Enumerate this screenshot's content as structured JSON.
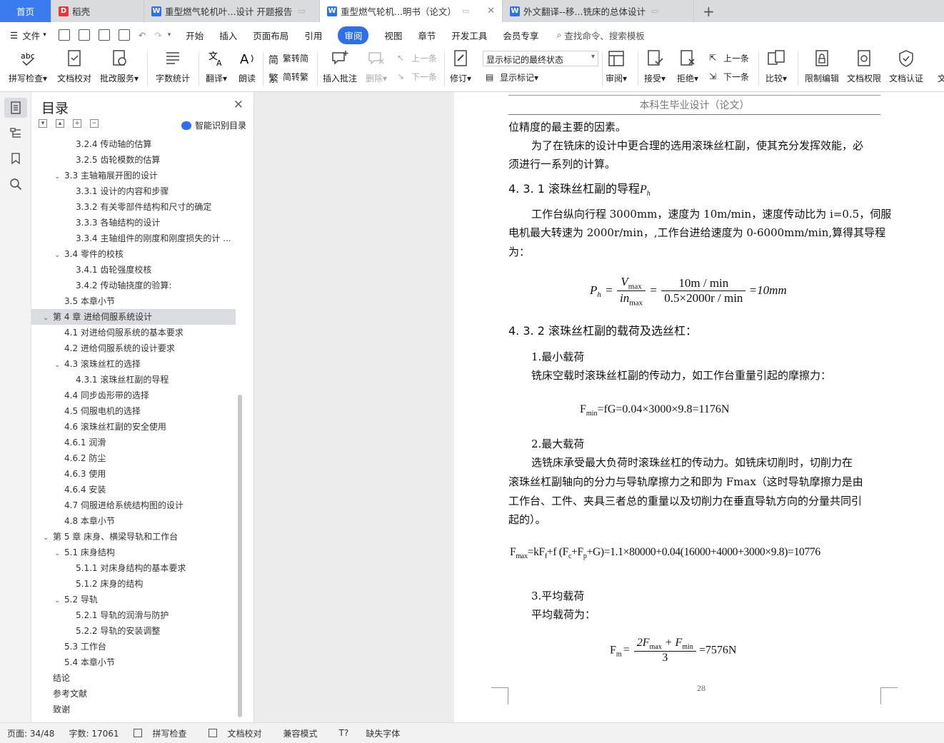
{
  "tabs": [
    {
      "label": "首页",
      "kind": "home"
    },
    {
      "label": "稻壳",
      "kind": "d"
    },
    {
      "label": "重型燃气轮机叶...设计 开题报告",
      "kind": "w"
    },
    {
      "label": "重型燃气轮机...明书（论文）",
      "kind": "w",
      "active": true
    },
    {
      "label": "外文翻译--移...铣床的总体设计",
      "kind": "w"
    }
  ],
  "menu": {
    "file": "文件",
    "items": [
      "开始",
      "插入",
      "页面布局",
      "引用",
      "审阅",
      "视图",
      "章节",
      "开发工具",
      "会员专享"
    ],
    "selected": "审阅",
    "search": "查找命令、搜索模板"
  },
  "ribbon": {
    "spell": "拼写检查",
    "doccheck": "文档校对",
    "correct": "批改服务",
    "wordcount": "字数统计",
    "translate": "翻译",
    "read": "朗读",
    "trad": "繁转简",
    "simp": "简转繁",
    "insert_comment": "插入批注",
    "delete": "删除",
    "prev1": "上一条",
    "next1": "下一条",
    "revise": "修订",
    "display_select": "显示标记的最终状态",
    "show_marks": "显示标记",
    "review": "审阅",
    "accept": "接受",
    "reject": "拒绝",
    "prev2": "上一条",
    "next2": "下一条",
    "compare": "比较",
    "limit_edit": "限制编辑",
    "doc_rights": "文档权限",
    "doc_cert": "文档认证",
    "doc_more": "文"
  },
  "toc": {
    "title": "目录",
    "smart": "智能识别目录",
    "items": [
      {
        "t": "3.2.4 传动轴的估算",
        "l": 3
      },
      {
        "t": "3.2.5 齿轮模数的估算",
        "l": 3
      },
      {
        "t": "3.3 主轴箱展开图的设计",
        "l": 2,
        "c": true
      },
      {
        "t": "3.3.1 设计的内容和步骤",
        "l": 3
      },
      {
        "t": "3.3.2  有关零部件结构和尺寸的确定",
        "l": 3
      },
      {
        "t": "3.3.3  各轴结构的设计",
        "l": 3
      },
      {
        "t": "3.3.4  主轴组件的刚度和刚度损失的计 ...",
        "l": 3
      },
      {
        "t": "3.4  零件的校核",
        "l": 2,
        "c": true
      },
      {
        "t": "3.4.1 齿轮强度校核",
        "l": 3
      },
      {
        "t": "3.4.2 传动轴挠度的验算:",
        "l": 3
      },
      {
        "t": "3.5  本章小节",
        "l": 2
      },
      {
        "t": "第 4 章  进给伺服系统设计",
        "l": 1,
        "c": true,
        "hl": true
      },
      {
        "t": "4.1  对进给伺服系统的基本要求",
        "l": 2
      },
      {
        "t": "4.2 进给伺服系统的设计要求",
        "l": 2
      },
      {
        "t": "4.3 滚珠丝杠的选择",
        "l": 2,
        "c": true
      },
      {
        "t": "4.3.1  滚珠丝杠副的导程",
        "l": 3
      },
      {
        "t": "4.4 同步齿形带的选择",
        "l": 2
      },
      {
        "t": "4.5 伺服电机的选择",
        "l": 2
      },
      {
        "t": "4.6  滚珠丝杠副的安全使用",
        "l": 2
      },
      {
        "t": "4.6.1  润滑",
        "l": 2
      },
      {
        "t": "4.6.2  防尘",
        "l": 2
      },
      {
        "t": "4.6.3 使用",
        "l": 2
      },
      {
        "t": "4.6.4  安装",
        "l": 2
      },
      {
        "t": "4.7  伺服进给系统结构图的设计",
        "l": 2
      },
      {
        "t": "4.8  本章小节",
        "l": 2
      },
      {
        "t": "第 5 章  床身、横梁导轨和工作台",
        "l": 1,
        "c": true
      },
      {
        "t": "5.1  床身结构",
        "l": 2,
        "c": true
      },
      {
        "t": "5.1.1  对床身结构的基本要求",
        "l": 3
      },
      {
        "t": "5.1.2  床身的结构",
        "l": 3
      },
      {
        "t": "5.2  导轨",
        "l": 2,
        "c": true
      },
      {
        "t": "5.2.1  导轨的润滑与防护",
        "l": 3
      },
      {
        "t": "5.2.2  导轨的安装调整",
        "l": 3
      },
      {
        "t": "5.3  工作台",
        "l": 2
      },
      {
        "t": "5.4  本章小节",
        "l": 2
      },
      {
        "t": "结论",
        "l": 1
      },
      {
        "t": "参考文献",
        "l": 1
      },
      {
        "t": "致谢",
        "l": 1
      }
    ]
  },
  "page": {
    "header": "本科生毕业设计（论文）",
    "p1": "位精度的最主要的因素。",
    "p2a": "为了在铣床的设计中更合理的选用滚珠丝杠副，使其充分发挥效能，必",
    "p2b": "须进行一系列的计算。",
    "h1": "4. 3. 1  滚珠丝杠副的导程",
    "h1sym": "P",
    "h1sub": "h",
    "p3a": "工作台纵向行程 3000mm，速度为 10m/min，速度传动比为 i=0.5，伺服",
    "p3b": "电机最大转速为 2000r/min，,工作台进给速度为 0-6000mm/min,算得其导程",
    "p3c": "为：",
    "eq1": {
      "lhs": "P",
      "lhs_sub": "h",
      "n1": "V",
      "n1s": "max",
      "d1": "in",
      "d1s": "max",
      "n2": "10m / min",
      "d2": "0.5×2000r / min",
      "rhs": "=10mm"
    },
    "h2": "4. 3. 2  滚珠丝杠副的载荷及选丝杠：",
    "l1": "1.最小载荷",
    "l1t": "铣床空载时滚珠丝杠副的传动力，如工作台重量引起的摩擦力：",
    "eq2": {
      "lhs": "F",
      "sub": "min",
      "rhs": "=fG=0.04×3000×9.8=1176N"
    },
    "l2": "2.最大载荷",
    "l2a": "选铣床承受最大负荷时滚珠丝杠的传动力。如铣床切削时，切削力在",
    "l2b": "滚珠丝杠副轴向的分力与导轨摩擦力之和即为 Fmax（这时导轨摩擦力是由",
    "l2c": "工作台、工件、夹具三者总的重量以及切削力在垂直导轨方向的分量共同引",
    "l2d": "起的）。",
    "eq3": "=kF",
    "eq3full": {
      "lhs": "F",
      "sub": "max",
      "a": "=kF",
      "as": "f",
      "b": "+f (F",
      "bs": "c",
      "c": "+F",
      "cs": "p",
      "d": "+G)=1.1×80000+0.04(16000+4000+3000×9.8)=10776"
    },
    "l3": "3.平均载荷",
    "l3t": "平均载荷为：",
    "eq4": {
      "lhs": "F",
      "sub": "m",
      "num": "2F",
      "nums": "max",
      "num2": " + F",
      "num2s": "min",
      "den": "3",
      "rhs": "=7576N"
    },
    "page_no": "28"
  },
  "status": {
    "page": "页面: 34/48",
    "words": "字数: 17061",
    "spell": "拼写检查",
    "check": "文档校对",
    "compat": "兼容模式",
    "font": "缺失字体"
  }
}
